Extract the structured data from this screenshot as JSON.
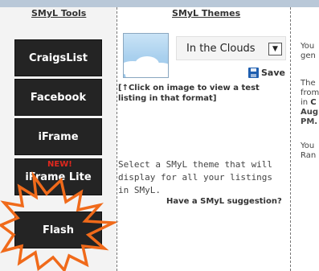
{
  "tools": {
    "title": "SMyL Tools",
    "buttons": [
      "CraigsList",
      "Facebook",
      "iFrame",
      "iFrame Lite",
      "Flash"
    ],
    "new_badge": "NEW!"
  },
  "themes": {
    "title": "SMyL Themes",
    "selected_theme": "In the Clouds",
    "save_label": "Save",
    "note": "[↑Click on image to view a test listing in that format]",
    "description": "Select a SMyL theme that will display for all your listings in SMyL.",
    "suggestion_link": "Have a SMyL suggestion?"
  },
  "info": {
    "p1_l1": "You",
    "p1_l2": "gen",
    "p2_l1": "The",
    "p2_l2": "from",
    "p2_l3_pre": "in ",
    "p2_l3_bold": "C",
    "p2_l4": "Aug",
    "p2_l5": "PM.",
    "p3_l1": "You",
    "p3_l2": "Ran"
  },
  "colors": {
    "button_bg": "#242424",
    "badge": "#e0281e",
    "burst": "#f06a1a",
    "save_icon": "#1f5fb0"
  },
  "icons": [
    "save-disk-icon",
    "dropdown-arrow-icon",
    "starburst-highlight"
  ]
}
